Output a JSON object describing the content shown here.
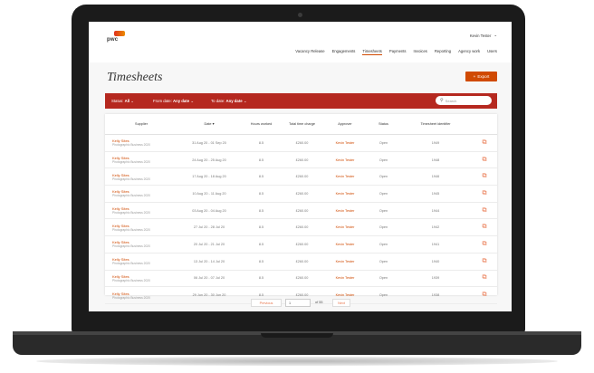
{
  "app": {
    "logo_text": "pwc",
    "user_name": "Kevin Tester",
    "user_caret": "⌄"
  },
  "nav": [
    {
      "label": "Vacancy Release",
      "active": false
    },
    {
      "label": "Engagements",
      "active": false
    },
    {
      "label": "Timesheets",
      "active": true
    },
    {
      "label": "Payments",
      "active": false
    },
    {
      "label": "Invoices",
      "active": false
    },
    {
      "label": "Reporting",
      "active": false
    },
    {
      "label": "Agency work",
      "active": false
    },
    {
      "label": "Users",
      "active": false
    }
  ],
  "page_title": "Timesheets",
  "export_label": "Export",
  "filters": {
    "status_label": "Status:",
    "status_value": "All",
    "from_label": "From date:",
    "from_value": "Any date",
    "to_label": "To date:",
    "to_value": "Any date",
    "search_placeholder": "Search"
  },
  "table": {
    "headers": [
      "Supplier",
      "Date ▾",
      "Hours worked",
      "Total time charge",
      "Approver",
      "Status",
      "Timesheet identifier",
      ""
    ],
    "rows": [
      {
        "supplier": "Kelly Sites",
        "sub": "Photographic Business 2020",
        "date": "31 Aug 20 - 01 Sep 20",
        "hours": "8.5",
        "charge": "£260.00",
        "approver": "Kevin Tester",
        "status": "Open",
        "id": "1949"
      },
      {
        "supplier": "Kelly Sites",
        "sub": "Photographic Business 2020",
        "date": "24 Aug 20 - 25 Aug 20",
        "hours": "8.5",
        "charge": "£260.00",
        "approver": "Kevin Tester",
        "status": "Open",
        "id": "1948"
      },
      {
        "supplier": "Kelly Sites",
        "sub": "Photographic Business 2020",
        "date": "17 Aug 20 - 18 Aug 20",
        "hours": "8.5",
        "charge": "£260.00",
        "approver": "Kevin Tester",
        "status": "Open",
        "id": "1946"
      },
      {
        "supplier": "Kelly Sites",
        "sub": "Photographic Business 2020",
        "date": "10 Aug 20 - 11 Aug 20",
        "hours": "8.5",
        "charge": "£260.00",
        "approver": "Kevin Tester",
        "status": "Open",
        "id": "1945"
      },
      {
        "supplier": "Kelly Sites",
        "sub": "Photographic Business 2020",
        "date": "03 Aug 20 - 04 Aug 20",
        "hours": "8.5",
        "charge": "£260.00",
        "approver": "Kevin Tester",
        "status": "Open",
        "id": "1944"
      },
      {
        "supplier": "Kelly Sites",
        "sub": "Photographic Business 2020",
        "date": "27 Jul 20 - 28 Jul 20",
        "hours": "8.5",
        "charge": "£260.00",
        "approver": "Kevin Tester",
        "status": "Open",
        "id": "1942"
      },
      {
        "supplier": "Kelly Sites",
        "sub": "Photographic Business 2020",
        "date": "20 Jul 20 - 21 Jul 20",
        "hours": "8.5",
        "charge": "£260.00",
        "approver": "Kevin Tester",
        "status": "Open",
        "id": "1941"
      },
      {
        "supplier": "Kelly Sites",
        "sub": "Photographic Business 2020",
        "date": "13 Jul 20 - 14 Jul 20",
        "hours": "8.5",
        "charge": "£260.00",
        "approver": "Kevin Tester",
        "status": "Open",
        "id": "1940"
      },
      {
        "supplier": "Kelly Sites",
        "sub": "Photographic Business 2020",
        "date": "06 Jul 20 - 07 Jul 20",
        "hours": "8.5",
        "charge": "£260.00",
        "approver": "Kevin Tester",
        "status": "Open",
        "id": "1939"
      },
      {
        "supplier": "Kelly Sites",
        "sub": "Photographic Business 2020",
        "date": "29 Jun 20 - 30 Jun 20",
        "hours": "8.5",
        "charge": "£260.00",
        "approver": "Kevin Tester",
        "status": "Open",
        "id": "1938"
      }
    ]
  },
  "pagination": {
    "prev_label": "Previous",
    "page_value": "1",
    "of_label": "of 55",
    "next_label": "Next"
  },
  "colors": {
    "accent": "#d04a02",
    "filter_bar": "#b5281f"
  },
  "icons": {
    "export": "plus-icon",
    "search": "search-icon",
    "row_action": "edit-icon"
  }
}
